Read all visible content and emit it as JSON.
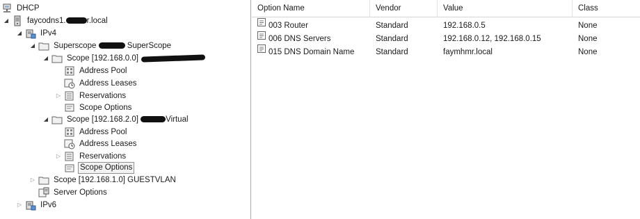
{
  "tree": {
    "dhcp_label": "DHCP",
    "server_label_prefix": "faycodns1.",
    "server_label_suffix": "r.local",
    "ipv4_label": "IPv4",
    "superscope_label_prefix": "Superscope ",
    "superscope_label_suffix": " SuperScope",
    "scope1_label": "Scope [192.168.0.0]",
    "scope1_children": {
      "address_pool": "Address Pool",
      "address_leases": "Address Leases",
      "reservations": "Reservations",
      "scope_options": "Scope Options"
    },
    "scope2_label_prefix": "Scope [192.168.2.0] ",
    "scope2_label_suffix": "Virtual",
    "scope2_children": {
      "address_pool": "Address Pool",
      "address_leases": "Address Leases",
      "reservations": "Reservations",
      "scope_options": "Scope Options"
    },
    "scope3_label": "Scope [192.168.1.0] GUESTVLAN",
    "server_options_label": "Server Options",
    "ipv6_label": "IPv6"
  },
  "list": {
    "columns": [
      "Option Name",
      "Vendor",
      "Value",
      "Class"
    ],
    "rows": [
      {
        "option_name": "003 Router",
        "vendor": "Standard",
        "value": "192.168.0.5",
        "class": "None"
      },
      {
        "option_name": "006 DNS Servers",
        "vendor": "Standard",
        "value": "192.168.0.12, 192.168.0.15",
        "class": "None"
      },
      {
        "option_name": "015 DNS Domain Name",
        "vendor": "Standard",
        "value": "faymhmr.local",
        "class": "None"
      }
    ]
  }
}
